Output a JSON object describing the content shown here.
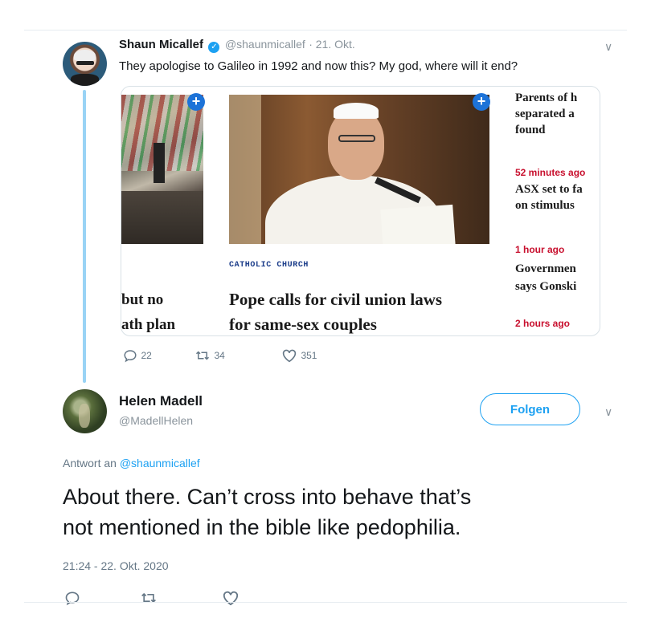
{
  "tweet1": {
    "name": "Shaun Micallef",
    "handle": "@shaunmicallef",
    "date": "· 21. Okt.",
    "text": "They apologise to Galileo in 1992 and now this? My god, where will it end?",
    "card": {
      "left_headline_line1": "but no",
      "left_headline_line2": "ath plan",
      "section": "CATHOLIC CHURCH",
      "headline_line1": "Pope calls for civil union laws",
      "headline_line2": "for same-sex couples",
      "right_items": [
        {
          "lines": [
            "Parents of h",
            "separated a",
            "found"
          ],
          "time": "52 minutes ago"
        },
        {
          "lines": [
            "ASX set to fa",
            "on stimulus"
          ],
          "time": "1 hour ago"
        },
        {
          "lines": [
            "Governmen",
            "says Gonski"
          ],
          "time": "2 hours ago"
        }
      ],
      "plus_symbol": "+"
    },
    "actions": {
      "replies": "22",
      "retweets": "34",
      "likes": "351"
    }
  },
  "tweet2": {
    "name": "Helen Madell",
    "handle": "@MadellHelen",
    "follow_label": "Folgen",
    "reply_to_prefix": "Antwort an",
    "reply_to_handle": "@shaunmicallef",
    "text_line1": "About there. Can’t cross into behave that’s",
    "text_line2": "not mentioned in the bible like pedophilia.",
    "timestamp": "21:24 - 22. Okt. 2020"
  },
  "colors": {
    "accent": "#1da1f2",
    "verified": "#1da1f2",
    "news_red": "#c8102e",
    "plus_blue": "#1d73d8"
  }
}
